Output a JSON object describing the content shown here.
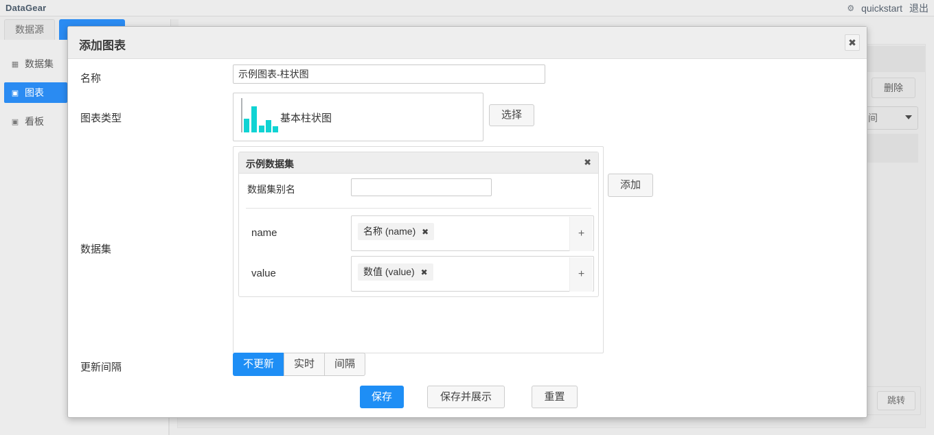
{
  "app": {
    "brand": "DataGear",
    "topright": {
      "gear_icon": "gear-icon",
      "user": "quickstart",
      "logout": "退出"
    }
  },
  "tabs": [
    {
      "label": "数据源",
      "active": false
    },
    {
      "label": "",
      "active": true
    }
  ],
  "sidebar": {
    "items": [
      {
        "icon": "grid-icon",
        "glyph": "▦",
        "label": "数据集",
        "active": false
      },
      {
        "icon": "image-icon",
        "glyph": "▣",
        "label": "图表",
        "active": true
      },
      {
        "icon": "dashboard-icon",
        "glyph": "▣",
        "label": "看板",
        "active": false
      }
    ]
  },
  "background": {
    "delete_button": "删除",
    "select_value": "间",
    "jump_button": "跳转"
  },
  "dialog": {
    "title": "添加图表",
    "close_glyph": "✖",
    "name": {
      "label": "名称",
      "value": "示例图表-柱状图",
      "placeholder": ""
    },
    "chart_type": {
      "label": "图表类型",
      "selected": "基本柱状图",
      "icon": "bar-chart-icon",
      "icon_color": "#10d3d3",
      "choose_button": "选择"
    },
    "dataset": {
      "label": "数据集",
      "add_button": "添加",
      "card": {
        "title": "示例数据集",
        "close_glyph": "✖",
        "alias_label": "数据集别名",
        "alias_value": "",
        "alias_placeholder": "",
        "signs": [
          {
            "name": "name",
            "tag_label": "名称 (name)",
            "tag_remove_glyph": "✖",
            "plus_glyph": "+"
          },
          {
            "name": "value",
            "tag_label": "数值 (value)",
            "tag_remove_glyph": "✖",
            "plus_glyph": "+"
          }
        ]
      }
    },
    "update_interval": {
      "label": "更新间隔",
      "options": [
        {
          "label": "不更新",
          "active": true
        },
        {
          "label": "实时",
          "active": false
        },
        {
          "label": "间隔",
          "active": false
        }
      ]
    },
    "footer": {
      "save": "保存",
      "save_and_show": "保存并展示",
      "reset": "重置"
    }
  },
  "colors": {
    "accent_blue": "#1e8ef5",
    "chart_teal": "#10d3d3"
  },
  "chart_icon_data": {
    "type": "bar",
    "values": [
      30,
      48,
      14,
      26,
      12
    ]
  }
}
